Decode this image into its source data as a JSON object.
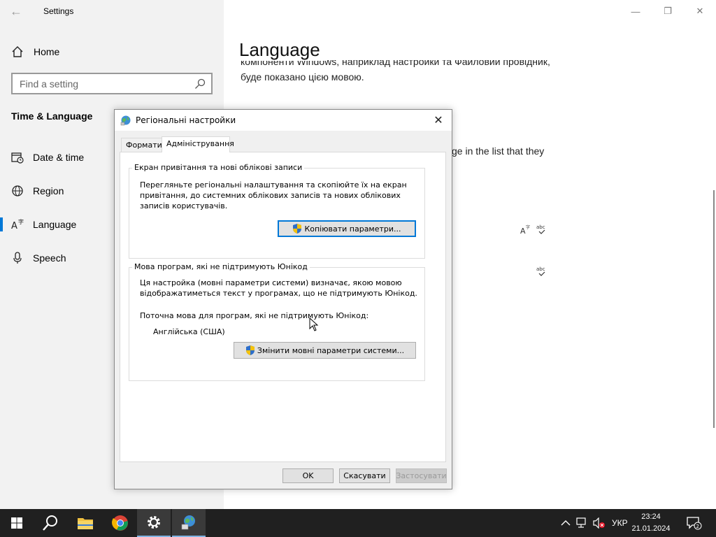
{
  "settings": {
    "title": "Settings",
    "home_label": "Home",
    "search_placeholder": "Find a setting",
    "section_title": "Time & Language",
    "nav": [
      {
        "label": "Date & time"
      },
      {
        "label": "Region"
      },
      {
        "label": "Language"
      },
      {
        "label": "Speech"
      }
    ],
    "selected_nav": "Language",
    "accent_color": "#0078d7"
  },
  "main": {
    "page_title": "Language",
    "partial_text_line1": "компоненти Windows, наприклад настройки та Файловий провідник,",
    "partial_text_line2": "буде показано цією мовою.",
    "partial_text_right": "ge in the list that they",
    "icons": [
      "display-language-icon",
      "spelling-icon",
      "spelling-icon"
    ]
  },
  "dialog": {
    "title": "Регіональні настройки",
    "tabs": [
      "Формати",
      "Адміністрування"
    ],
    "active_tab": "Адміністрування",
    "group1": {
      "title": "Екран привітання та нові облікові записи",
      "desc_line1": "Перегляньте регіональні налаштування та скопіюйте їх на екран",
      "desc_line2": "привітання, до системних облікових записів та нових облікових",
      "desc_line3": "записів користувачів.",
      "button": "Копіювати параметри..."
    },
    "group2": {
      "title": "Мова програм, які не підтримують Юнікод",
      "desc_line1": "Ця настройка (мовні параметри системи) визначає, якою мовою",
      "desc_line2": "відображатиметься текст у програмах, що не підтримують Юнікод.",
      "current_label": "Поточна мова для програм, які не підтримують Юнікод:",
      "current_value": "Англійська (США)",
      "button": "Змінити мовні параметри системи..."
    },
    "ok": "OK",
    "cancel": "Скасувати",
    "apply": "Застосувати"
  },
  "taskbar": {
    "apps": [
      "windows-start",
      "search",
      "file-explorer",
      "chrome",
      "settings",
      "regional-settings"
    ],
    "language": "УКР",
    "time": "23:24",
    "date": "21.01.2024",
    "notifications": "2"
  }
}
